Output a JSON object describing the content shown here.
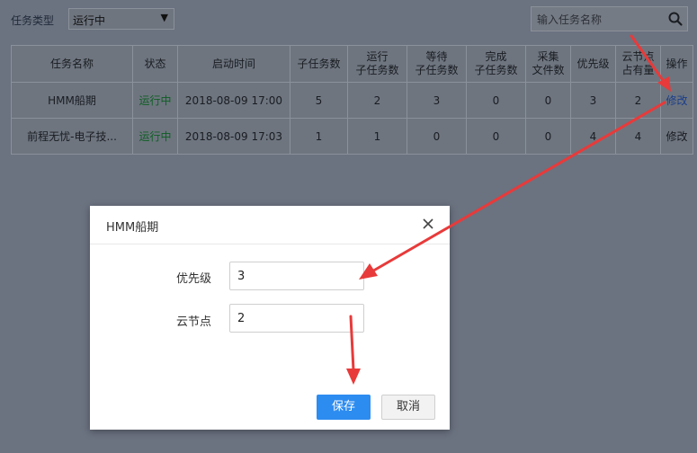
{
  "toolbar": {
    "task_type_label": "任务类型",
    "task_type_value": "运行中",
    "search_placeholder": "输入任务名称"
  },
  "table": {
    "headers": [
      [
        "任务名称"
      ],
      [
        "状态"
      ],
      [
        "启动时间"
      ],
      [
        "子任务数"
      ],
      [
        "运行",
        "子任务数"
      ],
      [
        "等待",
        "子任务数"
      ],
      [
        "完成",
        "子任务数"
      ],
      [
        "采集",
        "文件数"
      ],
      [
        "优先级"
      ],
      [
        "云节点",
        "占有量"
      ],
      [
        "操作"
      ]
    ],
    "rows": [
      {
        "name": "HMM船期",
        "status": "运行中",
        "start": "2018-08-09 17:00",
        "sub": "5",
        "running": "2",
        "waiting": "3",
        "done": "0",
        "files": "0",
        "priority": "3",
        "nodes": "2",
        "action": "修改"
      },
      {
        "name": "前程无忧-电子技...",
        "status": "运行中",
        "start": "2018-08-09 17:03",
        "sub": "1",
        "running": "1",
        "waiting": "0",
        "done": "0",
        "files": "0",
        "priority": "4",
        "nodes": "4",
        "action": "修改"
      }
    ]
  },
  "modal": {
    "title": "HMM船期",
    "priority_label": "优先级",
    "priority_value": "3",
    "cloud_label": "云节点",
    "cloud_value": "2",
    "save_label": "保存",
    "cancel_label": "取消"
  },
  "colors": {
    "overlay_bg": "#6b7280",
    "primary": "#2d8cf0",
    "running_status": "#0f5e24",
    "link": "#1b3e8a",
    "annotation_arrow": "#e83a3a"
  }
}
